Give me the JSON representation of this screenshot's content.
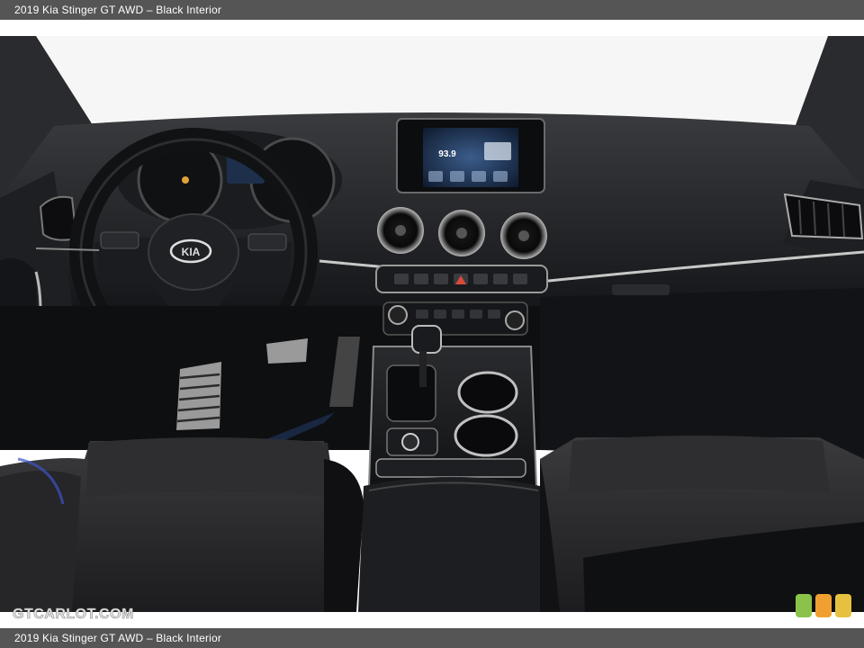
{
  "caption": {
    "top": "2019 Kia Stinger GT AWD – Black Interior",
    "bottom": "2019 Kia Stinger GT AWD – Black Interior"
  },
  "watermark": {
    "text": "GTCARLOT.COM"
  },
  "screen": {
    "readout": "93.9"
  },
  "badge_colors": [
    "#8bc34a",
    "#f0a030",
    "#e8c040"
  ]
}
